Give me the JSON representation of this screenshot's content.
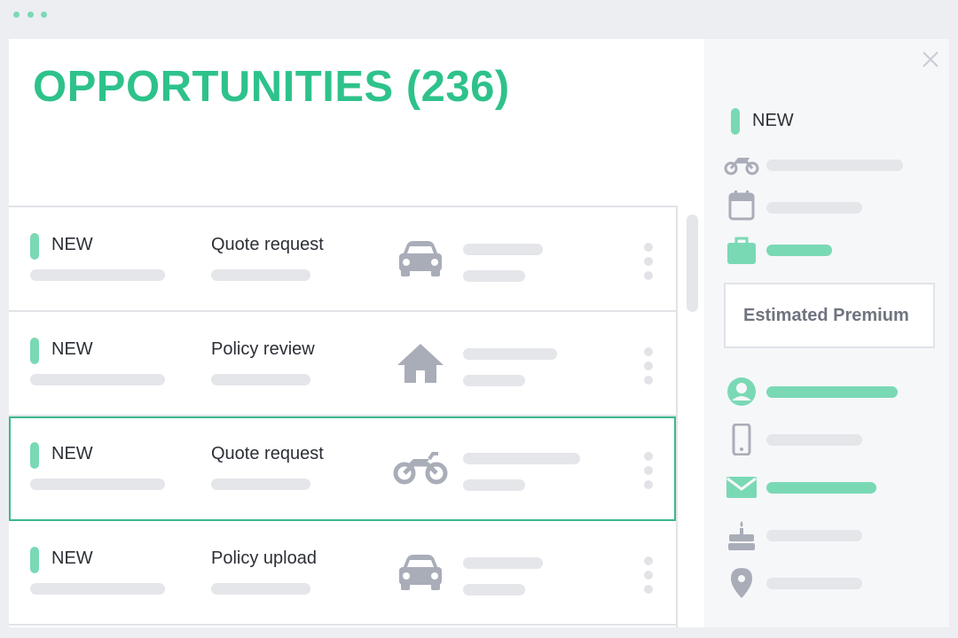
{
  "colors": {
    "accent": "#2ec28b",
    "accent_soft": "#7ad9b5",
    "icon_gray": "#a9adb8",
    "placeholder": "#e4e6ea",
    "window_dots": "#7ad9b5"
  },
  "page": {
    "title": "OPPORTUNITIES (236)"
  },
  "rows": [
    {
      "status": "NEW",
      "type": "Quote request",
      "icon": "car-icon",
      "selected": false
    },
    {
      "status": "NEW",
      "type": "Policy review",
      "icon": "house-icon",
      "selected": false
    },
    {
      "status": "NEW",
      "type": "Quote request",
      "icon": "motorcycle-icon",
      "selected": true
    },
    {
      "status": "NEW",
      "type": "Policy upload",
      "icon": "car-icon",
      "selected": false
    }
  ],
  "details": {
    "status": "NEW",
    "estimated_premium_label": "Estimated Premium",
    "icons": [
      "motorcycle-icon",
      "calendar-icon",
      "briefcase-icon",
      "user-icon",
      "phone-icon",
      "mail-icon",
      "birthday-cake-icon",
      "location-pin-icon"
    ]
  }
}
